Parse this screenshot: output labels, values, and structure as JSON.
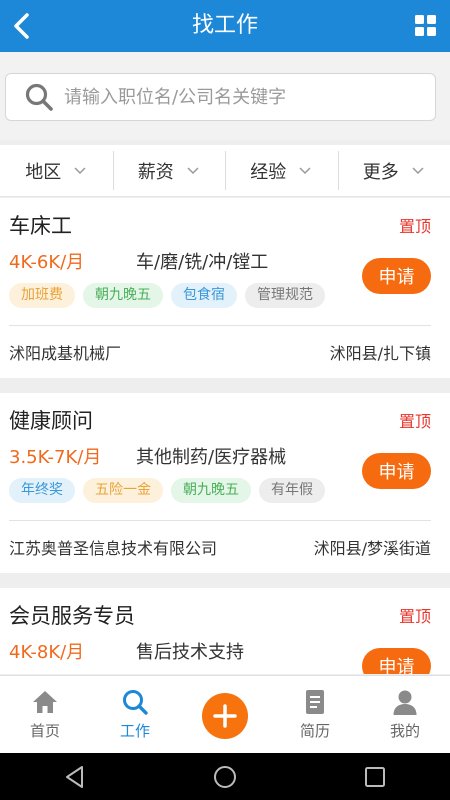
{
  "header": {
    "title": "找工作"
  },
  "search": {
    "placeholder": "请输入职位名/公司名关键字"
  },
  "filters": [
    {
      "label": "地区"
    },
    {
      "label": "薪资"
    },
    {
      "label": "经验"
    },
    {
      "label": "更多"
    }
  ],
  "jobs": [
    {
      "name": "车床工",
      "top": "置顶",
      "salary": "4K-6K/月",
      "category": "车/磨/铣/冲/镗工",
      "apply": "申请",
      "tags": [
        "加班费",
        "朝九晚五",
        "包食宿",
        "管理规范"
      ],
      "company": "沭阳成基机械厂",
      "location": "沭阳县/扎下镇"
    },
    {
      "name": "健康顾问",
      "top": "置顶",
      "salary": "3.5K-7K/月",
      "category": "其他制药/医疗器械",
      "apply": "申请",
      "tags": [
        "年终奖",
        "五险一金",
        "朝九晚五",
        "有年假"
      ],
      "company": "江苏奥普圣信息技术有限公司",
      "location": "沭阳县/梦溪街道"
    },
    {
      "name": "会员服务专员",
      "top": "置顶",
      "salary": "4K-8K/月",
      "category": "售后技术支持",
      "apply": "申请",
      "tags": [],
      "company": "",
      "location": ""
    }
  ],
  "tabbar": [
    {
      "label": "首页",
      "icon": "home-icon"
    },
    {
      "label": "工作",
      "icon": "search-icon"
    },
    {
      "label": "",
      "icon": "plus-icon"
    },
    {
      "label": "简历",
      "icon": "resume-icon"
    },
    {
      "label": "我的",
      "icon": "user-icon"
    }
  ],
  "colors": {
    "primary": "#1e88d8",
    "accent": "#f76b10",
    "pinned": "#e8362d",
    "salary": "#f06a1d"
  }
}
